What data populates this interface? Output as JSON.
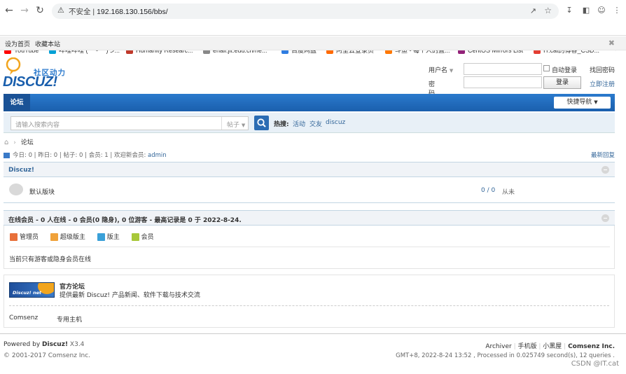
{
  "browser": {
    "security_label": "不安全",
    "url": "192.168.130.156/bbs/",
    "bookmarks": [
      {
        "label": "YouTube",
        "color": "#ff0000"
      },
      {
        "label": "哔哩哔哩 ( ゜- ゜)つ...",
        "color": "#00a1d6"
      },
      {
        "label": "Humanity Researc...",
        "color": "#c0392b"
      },
      {
        "label": "ehall.jit.edu.cn/ne...",
        "color": "#888888"
      },
      {
        "label": "百度网盘",
        "color": "#2f7de1"
      },
      {
        "label": "阿里云登录页",
        "color": "#ff6a00"
      },
      {
        "label": "斗鱼 - 每个人的直...",
        "color": "#ff7800"
      },
      {
        "label": "CentOS Mirrors List",
        "color": "#932279"
      },
      {
        "label": "IT.cat的博客_CSD...",
        "color": "#e33e33"
      }
    ]
  },
  "topbar": {
    "set_home": "设为首页",
    "bookmark": "收藏本站"
  },
  "logo": {
    "tagline": "社区动力",
    "wordmark": "DISCUZ!"
  },
  "login": {
    "username_label": "用户名",
    "password_label": "密码",
    "auto_login": "自动登录",
    "login_button": "登录",
    "find_password": "找回密码",
    "register": "立即注册"
  },
  "nav": {
    "forum_tab": "论坛",
    "quick_nav": "快捷导航"
  },
  "search": {
    "placeholder": "请输入搜索内容",
    "type": "帖子",
    "hot_label": "热搜:",
    "hot_terms": [
      "活动",
      "交友",
      "discuz"
    ]
  },
  "breadcrumb": {
    "current": "论坛"
  },
  "stats": {
    "text": "今日: 0 | 昨日: 0 | 帖子: 0 | 会员: 1 | 欢迎新会员: ",
    "new_member": "admin",
    "latest_reply": "最新回复"
  },
  "category": {
    "title": "Discuz!",
    "forum_name": "默认版块",
    "counts": "0 / 0",
    "last_post": "从未"
  },
  "online": {
    "title": "在线会员 - 0 人在线 - 0 会员(0 隐身), 0 位游客 - 最高记录是 0 于 2022-8-24.",
    "legend": [
      {
        "label": "管理员",
        "color": "#e8703a"
      },
      {
        "label": "超级版主",
        "color": "#f0a23a"
      },
      {
        "label": "版主",
        "color": "#3aa0d8"
      },
      {
        "label": "会员",
        "color": "#a8c83a"
      }
    ],
    "note": "当前只有游客或隐身会员在线"
  },
  "links": {
    "official_title": "官方论坛",
    "official_desc": "提供最新 Discuz! 产品新闻、软件下载与技术交流",
    "badge_text": "Discuz! net",
    "friend_links": [
      "Comsenz",
      "专用主机"
    ]
  },
  "footer": {
    "powered_by": "Powered by",
    "product": "Discuz!",
    "version": "X3.4",
    "copyright": "© 2001-2017 Comsenz Inc.",
    "links": [
      "Archiver",
      "手机版",
      "小黑屋",
      "Comsenz Inc."
    ],
    "timing": "GMT+8, 2022-8-24 13:52 , Processed in 0.025749 second(s), 12 queries .",
    "watermark": "CSDN @IT.cat"
  }
}
